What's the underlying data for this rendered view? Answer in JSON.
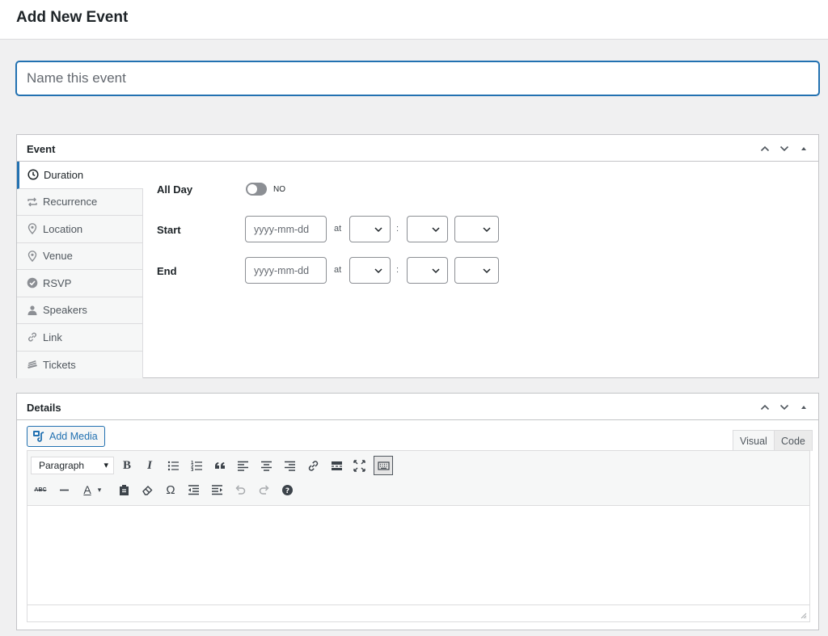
{
  "header": {
    "title": "Add New Event"
  },
  "title_field": {
    "placeholder": "Name this event",
    "value": ""
  },
  "event_box": {
    "title": "Event",
    "tabs": [
      {
        "label": "Duration",
        "icon": "clock-icon",
        "active": true
      },
      {
        "label": "Recurrence",
        "icon": "repeat-icon",
        "active": false
      },
      {
        "label": "Location",
        "icon": "map-pin-icon",
        "active": false
      },
      {
        "label": "Venue",
        "icon": "map-pin-icon",
        "active": false
      },
      {
        "label": "RSVP",
        "icon": "check-circle-icon",
        "active": false
      },
      {
        "label": "Speakers",
        "icon": "person-icon",
        "active": false
      },
      {
        "label": "Link",
        "icon": "link-icon",
        "active": false
      },
      {
        "label": "Tickets",
        "icon": "tickets-icon",
        "active": false
      }
    ],
    "all_day": {
      "label": "All Day",
      "state_text": "NO"
    },
    "start": {
      "label": "Start",
      "date_placeholder": "yyyy-mm-dd",
      "at": "at",
      "colon": ":"
    },
    "end": {
      "label": "End",
      "date_placeholder": "yyyy-mm-dd",
      "at": "at",
      "colon": ":"
    }
  },
  "details_box": {
    "title": "Details",
    "add_media_label": "Add Media",
    "tabs": {
      "visual": "Visual",
      "code": "Code"
    },
    "format_select": "Paragraph",
    "bold": "B",
    "italic": "I",
    "text_color": "A",
    "abc": "ABC"
  },
  "colors": {
    "accent": "#2271b1",
    "text": "#1d2327",
    "border": "#c3c4c7",
    "bg": "#f0f0f1"
  }
}
